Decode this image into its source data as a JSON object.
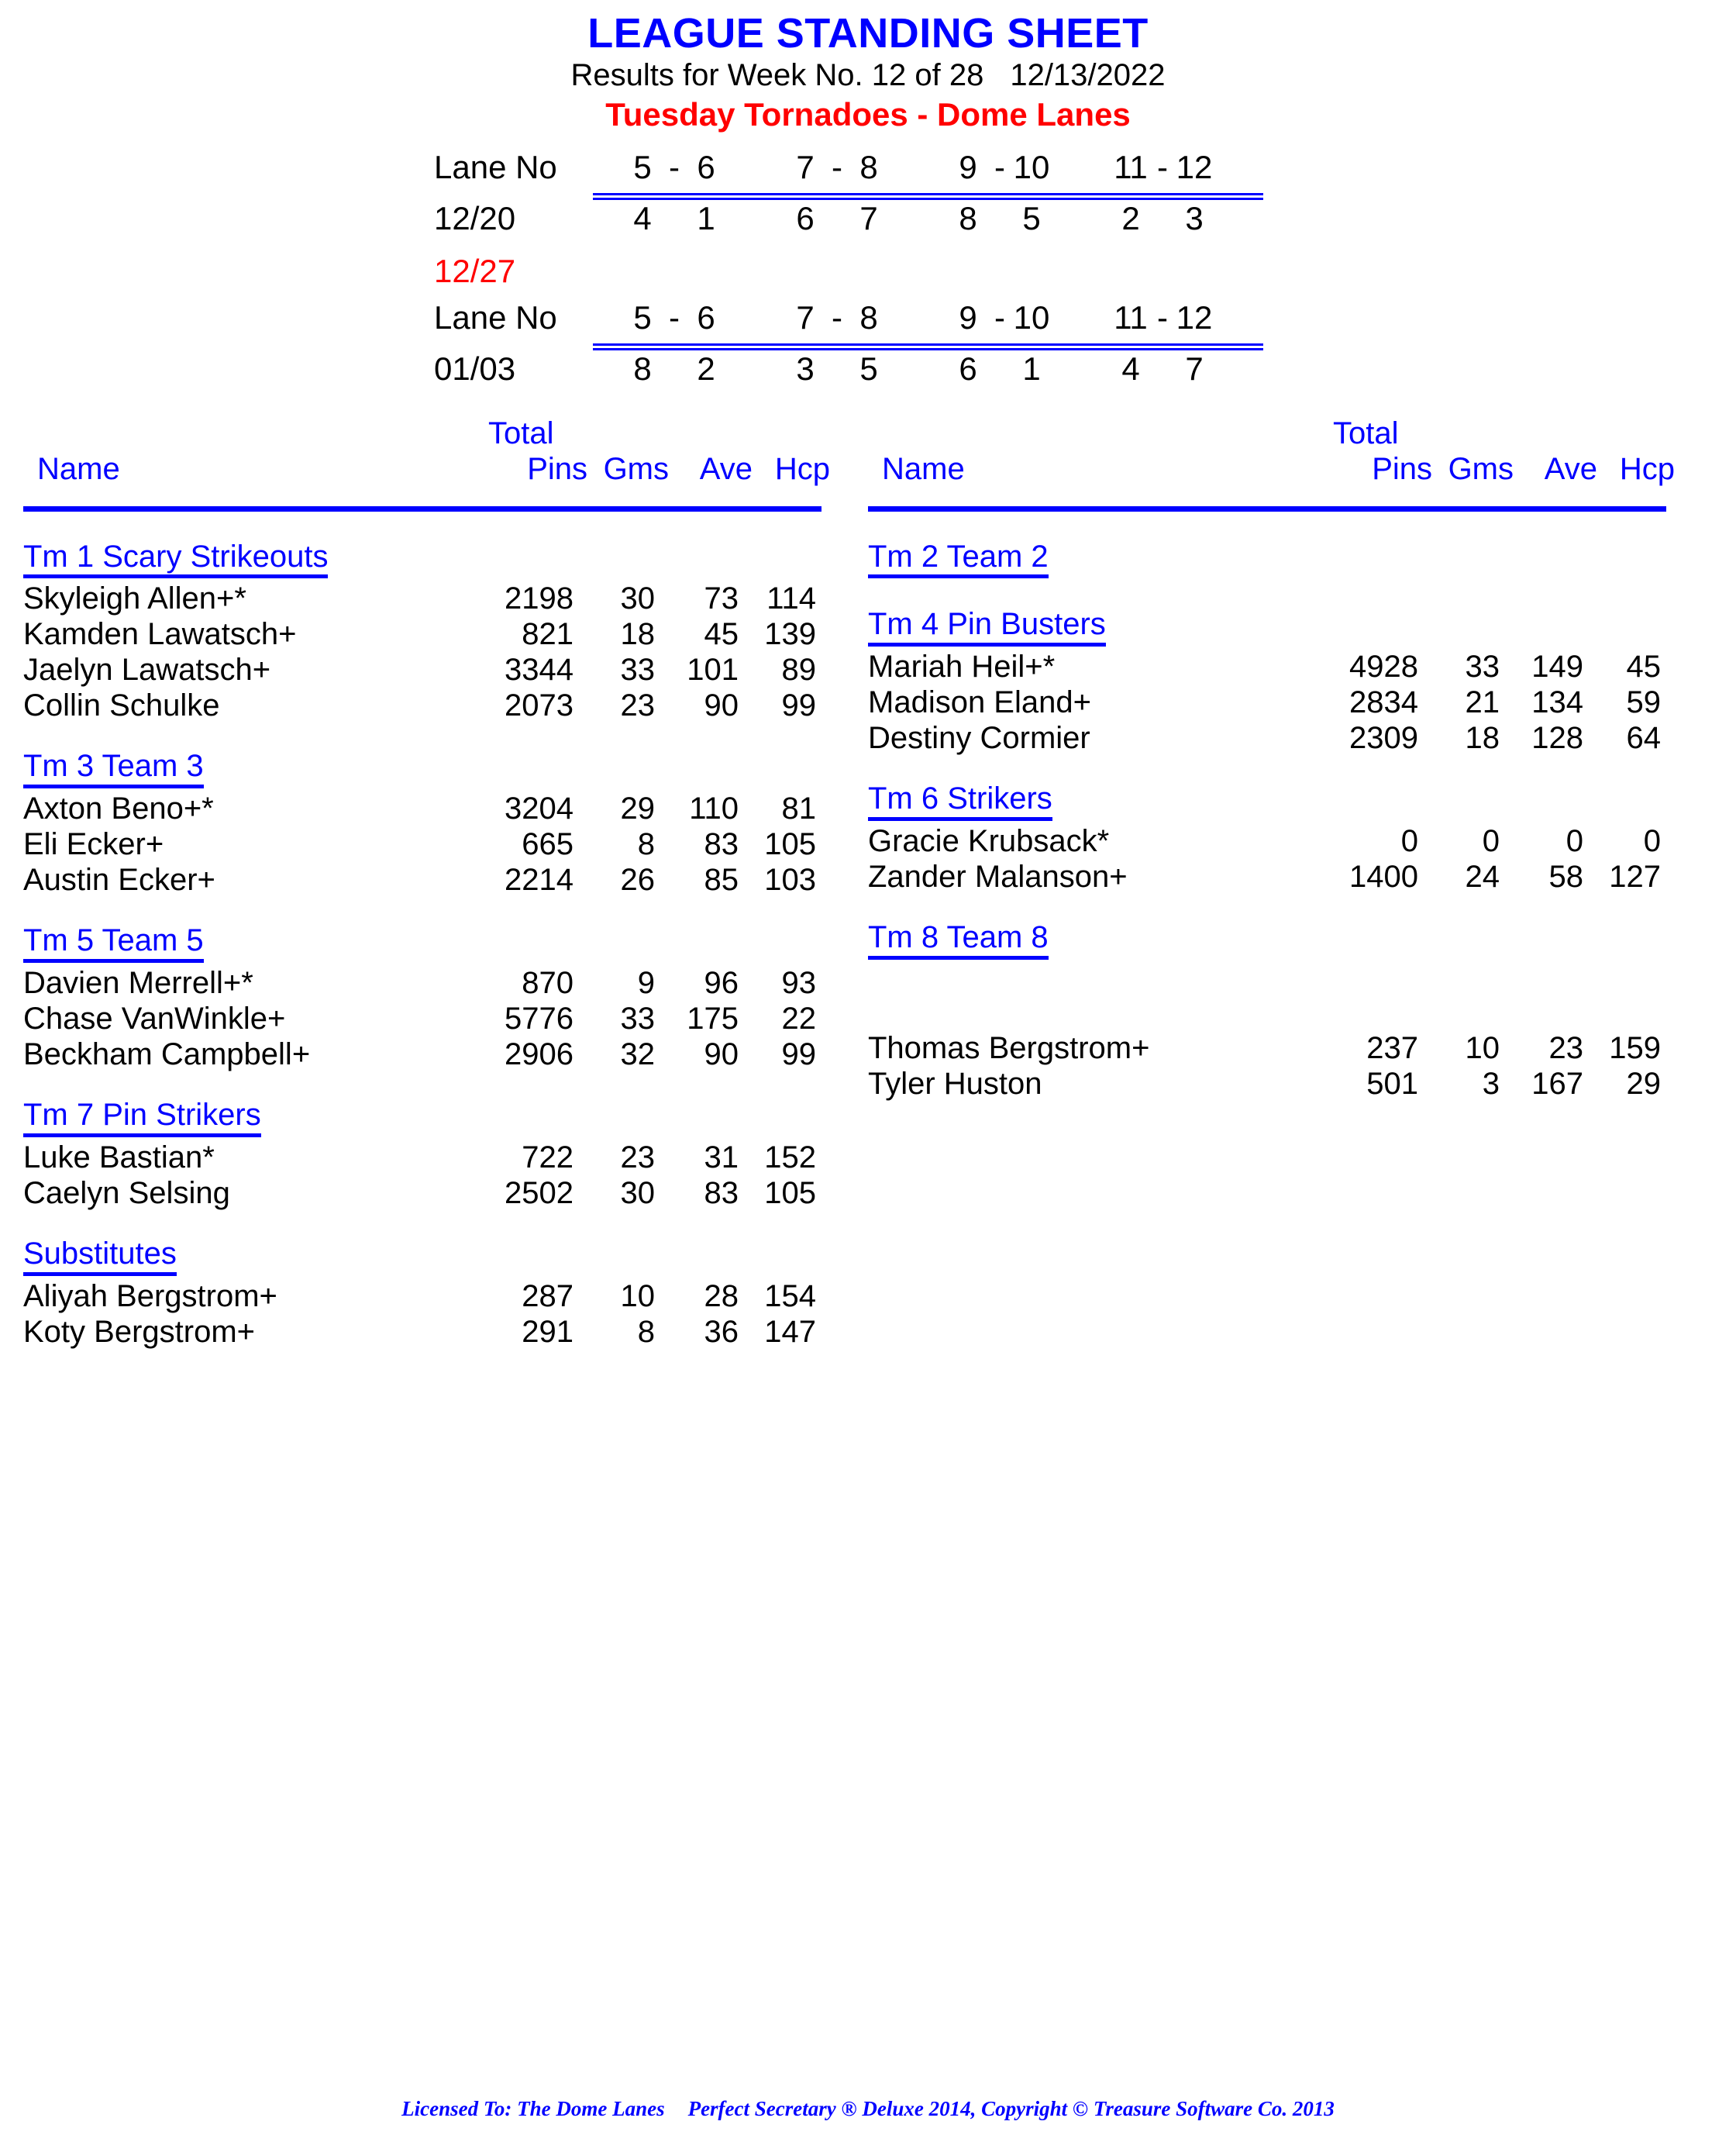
{
  "header": {
    "title": "LEAGUE STANDING SHEET",
    "results_line": "Results for Week No. 12 of 28",
    "date": "12/13/2022",
    "league": "Tuesday Tornadoes - Dome Lanes",
    "title_color": "#0000ff",
    "league_color": "#ff0000"
  },
  "schedules": [
    {
      "lane_label": "Lane No",
      "date_label": "12/20",
      "pairs": [
        {
          "lanes": [
            "5",
            "-",
            "6"
          ],
          "teams": [
            "4",
            "1"
          ]
        },
        {
          "lanes": [
            "7",
            "-",
            "8"
          ],
          "teams": [
            "6",
            "7"
          ]
        },
        {
          "lanes": [
            "9",
            "-",
            "10"
          ],
          "teams": [
            "8",
            "5"
          ]
        },
        {
          "lanes": [
            "11",
            "-",
            "12"
          ],
          "teams": [
            "2",
            "3"
          ]
        }
      ]
    },
    {
      "lane_label": "Lane No",
      "date_label": "01/03",
      "pairs": [
        {
          "lanes": [
            "5",
            "-",
            "6"
          ],
          "teams": [
            "8",
            "2"
          ]
        },
        {
          "lanes": [
            "7",
            "-",
            "8"
          ],
          "teams": [
            "3",
            "5"
          ]
        },
        {
          "lanes": [
            "9",
            "-",
            "10"
          ],
          "teams": [
            "6",
            "1"
          ]
        },
        {
          "lanes": [
            "11",
            "-",
            "12"
          ],
          "teams": [
            "4",
            "7"
          ]
        }
      ]
    }
  ],
  "mid_date": "12/27",
  "columns": {
    "header": {
      "total": "Total",
      "name": "Name",
      "pins": "Pins",
      "gms": "Gms",
      "ave": "Ave",
      "hcp": "Hcp"
    },
    "left": [
      {
        "team": "Tm 1 Scary Strikeouts",
        "players": [
          {
            "name": "Skyleigh Allen+*",
            "pins": "2198",
            "gms": "30",
            "ave": "73",
            "hcp": "114"
          },
          {
            "name": "Kamden Lawatsch+",
            "pins": "821",
            "gms": "18",
            "ave": "45",
            "hcp": "139"
          },
          {
            "name": "Jaelyn Lawatsch+",
            "pins": "3344",
            "gms": "33",
            "ave": "101",
            "hcp": "89"
          },
          {
            "name": "Collin Schulke",
            "pins": "2073",
            "gms": "23",
            "ave": "90",
            "hcp": "99"
          }
        ]
      },
      {
        "team": "Tm 3 Team 3",
        "players": [
          {
            "name": "Axton Beno+*",
            "pins": "3204",
            "gms": "29",
            "ave": "110",
            "hcp": "81"
          },
          {
            "name": "Eli Ecker+",
            "pins": "665",
            "gms": "8",
            "ave": "83",
            "hcp": "105"
          },
          {
            "name": "Austin Ecker+",
            "pins": "2214",
            "gms": "26",
            "ave": "85",
            "hcp": "103"
          }
        ]
      },
      {
        "team": "Tm 5 Team 5",
        "players": [
          {
            "name": "Davien Merrell+*",
            "pins": "870",
            "gms": "9",
            "ave": "96",
            "hcp": "93"
          },
          {
            "name": "Chase VanWinkle+",
            "pins": "5776",
            "gms": "33",
            "ave": "175",
            "hcp": "22"
          },
          {
            "name": "Beckham Campbell+",
            "pins": "2906",
            "gms": "32",
            "ave": "90",
            "hcp": "99"
          }
        ]
      },
      {
        "team": "Tm 7 Pin Strikers",
        "players": [
          {
            "name": "Luke Bastian*",
            "pins": "722",
            "gms": "23",
            "ave": "31",
            "hcp": "152"
          },
          {
            "name": "Caelyn Selsing",
            "pins": "2502",
            "gms": "30",
            "ave": "83",
            "hcp": "105"
          }
        ]
      },
      {
        "team": "Substitutes",
        "players": [
          {
            "name": "Aliyah Bergstrom+",
            "pins": "287",
            "gms": "10",
            "ave": "28",
            "hcp": "154"
          },
          {
            "name": "Koty Bergstrom+",
            "pins": "291",
            "gms": "8",
            "ave": "36",
            "hcp": "147"
          }
        ]
      }
    ],
    "right": [
      {
        "team": "Tm 2 Team 2",
        "players": []
      },
      {
        "team": "Tm 4 Pin Busters",
        "players": [
          {
            "name": "Mariah Heil+*",
            "pins": "4928",
            "gms": "33",
            "ave": "149",
            "hcp": "45"
          },
          {
            "name": "Madison Eland+",
            "pins": "2834",
            "gms": "21",
            "ave": "134",
            "hcp": "59"
          },
          {
            "name": "Destiny Cormier",
            "pins": "2309",
            "gms": "18",
            "ave": "128",
            "hcp": "64"
          }
        ]
      },
      {
        "team": "Tm 6 Strikers",
        "players": [
          {
            "name": "Gracie Krubsack*",
            "pins": "0",
            "gms": "0",
            "ave": "0",
            "hcp": "0"
          },
          {
            "name": "Zander Malanson+",
            "pins": "1400",
            "gms": "24",
            "ave": "58",
            "hcp": "127"
          }
        ]
      },
      {
        "team": "Tm 8 Team 8",
        "players": []
      },
      {
        "team": "",
        "players": [
          {
            "name": "Thomas Bergstrom+",
            "pins": "237",
            "gms": "10",
            "ave": "23",
            "hcp": "159"
          },
          {
            "name": "Tyler Huston",
            "pins": "501",
            "gms": "3",
            "ave": "167",
            "hcp": "29"
          }
        ]
      }
    ]
  },
  "footer": {
    "licensed": "Licensed To: The Dome Lanes",
    "copyright": "Perfect Secretary ® Deluxe  2014, Copyright © Treasure Software Co. 2013"
  }
}
